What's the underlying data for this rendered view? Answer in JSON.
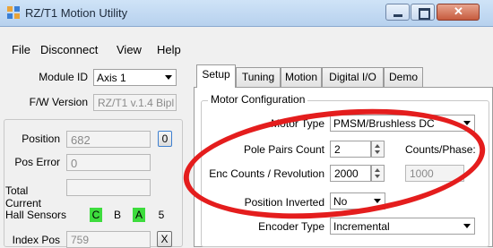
{
  "window": {
    "title": "RZ/T1 Motion Utility"
  },
  "menu": [
    "File",
    "Disconnect",
    "View",
    "Help"
  ],
  "left": {
    "module_id_label": "Module ID",
    "module_id_value": "Axis 1",
    "fw_version_label": "F/W Version",
    "fw_version_value": "RZ/T1 v.1.4 Bipl",
    "position_label": "Position",
    "position_value": "682",
    "position_reset": "0",
    "pos_error_label": "Pos Error",
    "pos_error_value": "0",
    "total_current_label": "Total Current",
    "total_current_value": "",
    "hall_sensors_label": "Hall Sensors",
    "hall_c": "C",
    "hall_b": "B",
    "hall_a": "A",
    "hall_value": "5",
    "index_pos_label": "Index Pos",
    "index_pos_value": "759",
    "index_reset": "X"
  },
  "tabs": [
    "Setup",
    "Tuning",
    "Motion",
    "Digital I/O",
    "Demo"
  ],
  "setup": {
    "group_title": "Motor Configuration",
    "motor_type_label": "Motor Type",
    "motor_type_value": "PMSM/Brushless DC",
    "pole_pairs_label": "Pole Pairs Count",
    "pole_pairs_value": "2",
    "counts_phase_label": "Counts/Phase:",
    "enc_counts_label": "Enc Counts / Revolution",
    "enc_counts_value": "2000",
    "counts_phase_value": "1000",
    "position_inverted_label": "Position Inverted",
    "position_inverted_value": "No",
    "encoder_type_label": "Encoder Type",
    "encoder_type_value": "Incremental"
  },
  "colors": {
    "hall_active": "#3ddc3d",
    "annotation": "#e41d1d"
  }
}
